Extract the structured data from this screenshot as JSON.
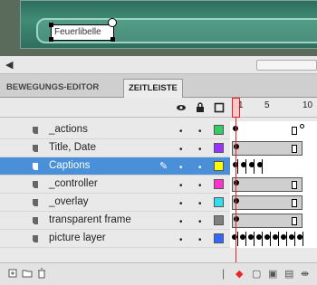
{
  "stage": {
    "label_text": "Feuerlibelle"
  },
  "tabs": [
    {
      "label": "BEWEGUNGS-EDITOR"
    },
    {
      "label": "ZEITLEISTE"
    }
  ],
  "ruler": {
    "marks": [
      "1",
      "5",
      "10"
    ]
  },
  "layers": [
    {
      "name": "_actions",
      "color": "#33cc66"
    },
    {
      "name": "Title, Date",
      "color": "#9933ff"
    },
    {
      "name": "Captions",
      "color": "#ffff00"
    },
    {
      "name": "_controller",
      "color": "#ff33cc"
    },
    {
      "name": "_overlay",
      "color": "#33ddee"
    },
    {
      "name": "transparent frame",
      "color": "#808080"
    },
    {
      "name": "picture layer",
      "color": "#3366ff"
    }
  ],
  "icons": {
    "eye": "eye-icon",
    "lock": "lock-icon",
    "outline": "outline-icon",
    "pencil": "pencil-icon",
    "new_layer": "new-layer-icon",
    "new_folder": "new-folder-icon",
    "trash": "trash-icon"
  }
}
